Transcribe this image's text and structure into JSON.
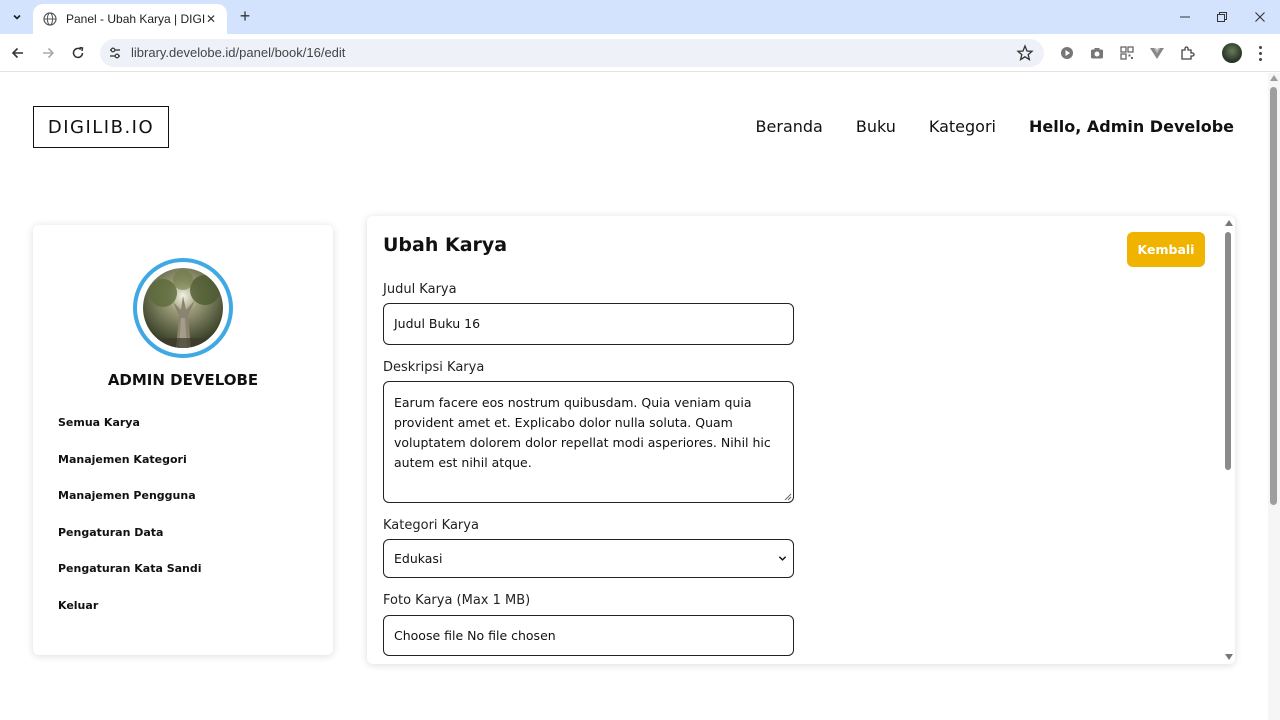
{
  "browser": {
    "tab_title": "Panel - Ubah Karya | DIGILIB",
    "url": "library.develobe.id/panel/book/16/edit"
  },
  "header": {
    "logo": "DIGILIB.IO",
    "nav": {
      "home": "Beranda",
      "books": "Buku",
      "categories": "Kategori",
      "greeting": "Hello, Admin Develobe"
    }
  },
  "sidebar": {
    "profile_name": "ADMIN DEVELOBE",
    "items": [
      {
        "label": "Semua Karya"
      },
      {
        "label": "Manajemen Kategori"
      },
      {
        "label": "Manajemen Pengguna"
      },
      {
        "label": "Pengaturan Data"
      },
      {
        "label": "Pengaturan Kata Sandi"
      },
      {
        "label": "Keluar"
      }
    ]
  },
  "main": {
    "title": "Ubah Karya",
    "back_label": "Kembali",
    "title_field": {
      "label": "Judul Karya",
      "value": "Judul Buku 16"
    },
    "description_field": {
      "label": "Deskripsi Karya",
      "value": "Earum facere eos nostrum quibusdam. Quia veniam quia provident amet et. Explicabo dolor nulla soluta. Quam voluptatem dolorem dolor repellat modi asperiores. Nihil hic autem est nihil atque."
    },
    "category_field": {
      "label": "Kategori Karya",
      "value": "Edukasi"
    },
    "photo_field": {
      "label": "Foto Karya (Max 1 MB)",
      "value": "Choose file No file chosen"
    }
  },
  "colors": {
    "accent_button": "#f0b400",
    "profile_ring": "#3fa9e3",
    "browser_tabbar": "#d3e3fd"
  }
}
